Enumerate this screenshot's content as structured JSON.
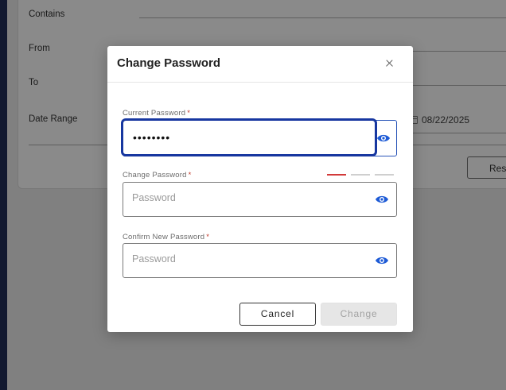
{
  "background": {
    "labels": {
      "contains": "Contains",
      "from": "From",
      "to": "To",
      "date_range": "Date Range"
    },
    "date_value": "08/22/2025",
    "reset_button": "Res"
  },
  "modal": {
    "title": "Change Password",
    "current_password": {
      "label": "Current Password",
      "required_mark": "*",
      "value": "••••••••"
    },
    "change_password": {
      "label": "Change Password",
      "required_mark": "*",
      "placeholder": "Password",
      "strength_colors": [
        "#d23a3a",
        "#cfcfcf",
        "#cfcfcf"
      ]
    },
    "confirm_password": {
      "label": "Confirm New Password",
      "required_mark": "*",
      "placeholder": "Password"
    },
    "buttons": {
      "cancel": "Cancel",
      "change": "Change"
    },
    "colors": {
      "accent": "#1e5bd6",
      "focus_border": "#1737a0"
    }
  }
}
